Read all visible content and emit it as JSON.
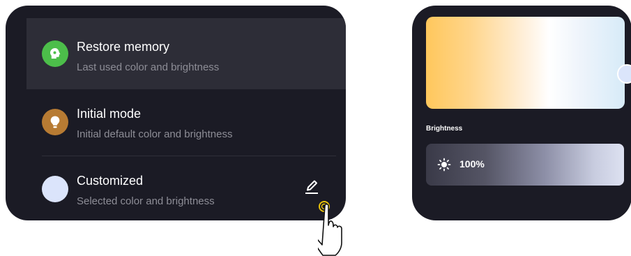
{
  "modes": [
    {
      "title": "Restore memory",
      "subtitle": "Last used color and brightness",
      "icon": "brain-icon",
      "icon_color": "#4cbe4a",
      "selected": true
    },
    {
      "title": "Initial mode",
      "subtitle": "Initial default color and brightness",
      "icon": "lightbulb-icon",
      "icon_color": "#b77b33",
      "selected": false
    },
    {
      "title": "Customized",
      "subtitle": "Selected color and brightness",
      "icon": "color-swatch-icon",
      "icon_color": "#dbe4fb",
      "selected": false
    }
  ],
  "edit_icon": "pencil-icon",
  "color_picker": {
    "gradient_colors": [
      "#ffc75c",
      "#ffffff",
      "#d7ebf8"
    ],
    "handle_color": "#dbe5fb"
  },
  "brightness": {
    "label": "Brightness",
    "value_text": "100%",
    "value": 100,
    "icon": "sun-icon"
  },
  "cursor": "hand-pointer-icon",
  "colors": {
    "panel_bg": "#1b1b25",
    "selected_row_bg": "#2d2d37",
    "text_primary": "#ffffff",
    "text_secondary": "#8d8d96",
    "tap_ring": "#e8c10a"
  }
}
